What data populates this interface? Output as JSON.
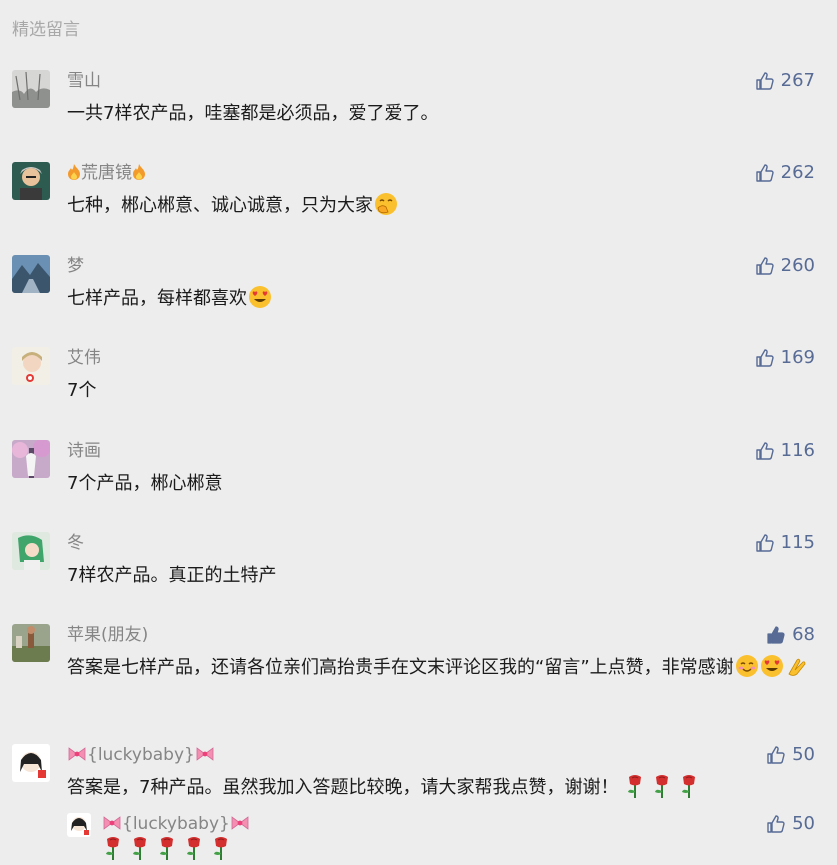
{
  "section_title": "精选留言",
  "comments": [
    {
      "nick": "雪山",
      "text": "一共7样农产品，哇塞都是必须品，爱了爱了。",
      "likes": "267"
    },
    {
      "nick": "荒唐镜",
      "text": "七种，郴心郴意、诚心诚意，只为大家",
      "likes": "262"
    },
    {
      "nick": "梦",
      "text": "七样产品，每样都喜欢",
      "likes": "260"
    },
    {
      "nick": "艾伟",
      "text": "7个",
      "likes": "169"
    },
    {
      "nick": "诗画",
      "text": "7个产品，郴心郴意",
      "likes": "116"
    },
    {
      "nick": "冬",
      "text": "7样农产品。真正的土特产",
      "likes": "115"
    },
    {
      "nick": "苹果(朋友)",
      "text": "答案是七样产品，还请各位亲们高抬贵手在文末评论区我的“留言”上点赞，非常感谢",
      "likes": "68"
    },
    {
      "nick": "{luckybaby}",
      "text": "答案是，7种产品。虽然我加入答题比较晚，请大家帮我点赞，谢谢！",
      "likes": "50"
    }
  ],
  "reply": {
    "nick": "{luckybaby}",
    "likes": "50"
  },
  "icons": {
    "thumb": "thumbs-up-icon",
    "thumb_filled": "thumbs-up-filled-icon",
    "flame": "flame-emoji",
    "bow": "ribbon-bow-emoji",
    "rose": "rose-emoji"
  },
  "colors": {
    "background": "#ededed",
    "nick": "#858585",
    "text": "#1b1b1b",
    "likes": "#576b95",
    "section_title": "#a8a8a8"
  }
}
